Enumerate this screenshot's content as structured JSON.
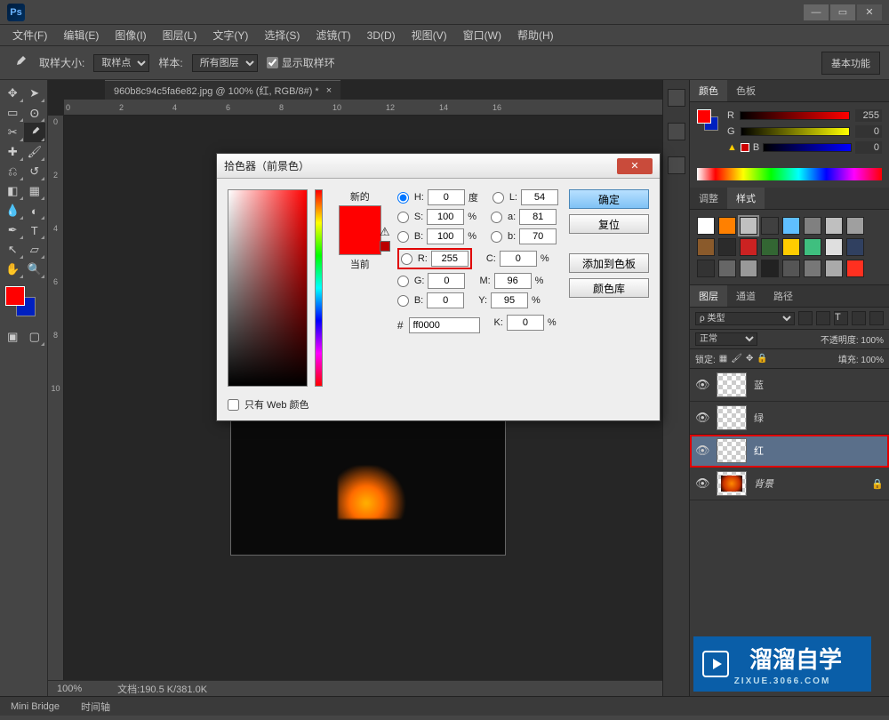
{
  "app": {
    "name": "Ps"
  },
  "menu": [
    "文件(F)",
    "编辑(E)",
    "图像(I)",
    "图层(L)",
    "文字(Y)",
    "选择(S)",
    "滤镜(T)",
    "3D(D)",
    "视图(V)",
    "窗口(W)",
    "帮助(H)"
  ],
  "options": {
    "sample_size_label": "取样大小:",
    "sample_size_value": "取样点",
    "sample_label": "样本:",
    "sample_value": "所有图层",
    "show_ring_label": "显示取样环",
    "workspace": "基本功能"
  },
  "document": {
    "tab": "960b8c94c5fa6e82.jpg @ 100% (红, RGB/8#) *",
    "zoom": "100%",
    "doc_info": "文档:190.5 K/381.0K"
  },
  "ruler_h": [
    "0",
    "2",
    "4",
    "6",
    "8",
    "10",
    "12",
    "14",
    "16"
  ],
  "ruler_v": [
    "0",
    "2",
    "4",
    "6",
    "8",
    "10"
  ],
  "color_panel": {
    "tabs": [
      "颜色",
      "色板"
    ],
    "r_label": "R",
    "r_val": "255",
    "g_label": "G",
    "g_val": "0",
    "b_label": "B",
    "b_val": "0"
  },
  "swatch_tabs": [
    "调整",
    "样式"
  ],
  "layers_panel": {
    "tabs": [
      "图层",
      "通道",
      "路径"
    ],
    "kind_label": "ρ 类型",
    "blend_mode": "正常",
    "opacity_label": "不透明度:",
    "opacity_val": "100%",
    "lock_label": "锁定:",
    "fill_label": "填充:",
    "fill_val": "100%",
    "layers": [
      {
        "name": "蓝",
        "visible": true,
        "thumb": "checker"
      },
      {
        "name": "绿",
        "visible": true,
        "thumb": "checker"
      },
      {
        "name": "红",
        "visible": true,
        "thumb": "checker",
        "selected": true,
        "highlight": true
      },
      {
        "name": "背景",
        "visible": true,
        "thumb": "flame",
        "locked": true,
        "italic": true
      }
    ]
  },
  "color_picker": {
    "title": "拾色器（前景色）",
    "new_label": "新的",
    "current_label": "当前",
    "ok": "确定",
    "reset": "复位",
    "add_swatch": "添加到色板",
    "color_lib": "颜色库",
    "H": {
      "label": "H:",
      "val": "0",
      "unit": "度"
    },
    "S": {
      "label": "S:",
      "val": "100",
      "unit": "%"
    },
    "Bh": {
      "label": "B:",
      "val": "100",
      "unit": "%"
    },
    "R": {
      "label": "R:",
      "val": "255"
    },
    "G": {
      "label": "G:",
      "val": "0"
    },
    "B": {
      "label": "B:",
      "val": "0"
    },
    "L": {
      "label": "L:",
      "val": "54"
    },
    "a": {
      "label": "a:",
      "val": "81"
    },
    "b": {
      "label": "b:",
      "val": "70"
    },
    "C": {
      "label": "C:",
      "val": "0",
      "unit": "%"
    },
    "M": {
      "label": "M:",
      "val": "96",
      "unit": "%"
    },
    "Y": {
      "label": "Y:",
      "val": "95",
      "unit": "%"
    },
    "K": {
      "label": "K:",
      "val": "0",
      "unit": "%"
    },
    "hex_label": "#",
    "hex_val": "ff0000",
    "web_only": "只有 Web 颜色"
  },
  "bottom": [
    "Mini Bridge",
    "时间轴"
  ],
  "watermark": {
    "text": "溜溜自学",
    "sub": "ZIXUE.3066.COM"
  },
  "swatch_colors": [
    [
      "#ffffff",
      "#ff8000",
      "#c0c0c0",
      "#404040",
      "#5fbfff",
      "#808080",
      "#bfbfbf",
      "#9f9f9f"
    ],
    [
      "#8a5a2b",
      "#2b2b2b",
      "#cc2222",
      "#336633",
      "#ffcc00",
      "#3fbf7f",
      "#dfdfdf",
      "#304060"
    ],
    [
      "#333333",
      "#666666",
      "#999999",
      "#222222",
      "#555555",
      "#777777",
      "#aaaaaa",
      "#ff3020"
    ]
  ]
}
